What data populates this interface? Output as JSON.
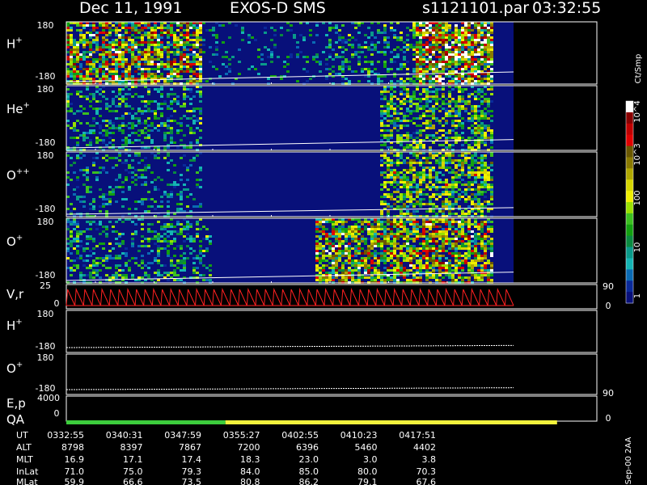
{
  "header": {
    "date": "Dec 11, 1991",
    "instrument": "EXOS-D SMS",
    "file": "s1121101.par",
    "time": "03:32:55"
  },
  "colorbar": {
    "units": "Ct/Smp",
    "ticks": [
      "10^4",
      "10^3",
      "100",
      "10",
      "1"
    ],
    "colors": [
      "#ffffff",
      "#8a0000",
      "#c00000",
      "#e00000",
      "#6a5800",
      "#8a7a00",
      "#b0a800",
      "#d6d600",
      "#f0f000",
      "#9ae000",
      "#3cc020",
      "#13a010",
      "#0a8a40",
      "#0a9a8a",
      "#14b4b4",
      "#0a6ab4",
      "#0a2a9a",
      "#08107a"
    ]
  },
  "chart_data": [
    {
      "type": "heatmap",
      "panel": "H+",
      "label": {
        "base": "H",
        "sup": "+"
      },
      "ylim": [
        -180,
        180
      ],
      "ticks": [
        "180",
        "-180"
      ],
      "activity": [
        {
          "t": [
            0,
            0.3
          ],
          "level": 0.75
        },
        {
          "t": [
            0.3,
            0.58
          ],
          "level": 0.15
        },
        {
          "t": [
            0.58,
            0.78
          ],
          "level": 0.35
        },
        {
          "t": [
            0.78,
            0.95
          ],
          "level": 0.85
        }
      ],
      "trace": [
        -180,
        -110
      ]
    },
    {
      "type": "heatmap",
      "panel": "He+",
      "label": {
        "base": "He",
        "sup": "+"
      },
      "ylim": [
        -180,
        180
      ],
      "ticks": [
        "180",
        "-180"
      ],
      "activity": [
        {
          "t": [
            0,
            0.3
          ],
          "level": 0.35
        },
        {
          "t": [
            0.7,
            0.95
          ],
          "level": 0.55
        }
      ],
      "trace": [
        -180,
        -120
      ]
    },
    {
      "type": "heatmap",
      "panel": "O++",
      "label": {
        "base": "O",
        "sup": "++"
      },
      "ylim": [
        -180,
        180
      ],
      "ticks": [
        "180",
        "-180"
      ],
      "activity": [
        {
          "t": [
            0,
            0.3
          ],
          "level": 0.25
        },
        {
          "t": [
            0.7,
            0.95
          ],
          "level": 0.6
        }
      ],
      "trace": [
        -180,
        -130
      ]
    },
    {
      "type": "heatmap",
      "panel": "O+",
      "label": {
        "base": "O",
        "sup": "+"
      },
      "ylim": [
        -180,
        180
      ],
      "ticks": [
        "180",
        "-180"
      ],
      "activity": [
        {
          "t": [
            0,
            0.32
          ],
          "level": 0.35
        },
        {
          "t": [
            0.55,
            0.95
          ],
          "level": 0.75
        }
      ],
      "trace": [
        -180,
        -120
      ]
    },
    {
      "type": "line",
      "panel": "V,r",
      "label": "V,r",
      "ylim": [
        0,
        25
      ],
      "ticks": [
        "25",
        "0"
      ],
      "right_ticks": [
        "90",
        "0"
      ],
      "sawtooth_periods": 52,
      "color": "#ff2020"
    },
    {
      "type": "line",
      "panel": "H+ trace",
      "label": {
        "base": "H",
        "sup": "+"
      },
      "ylim": [
        -180,
        180
      ],
      "ticks": [
        "180",
        "-180"
      ],
      "trace": [
        -180,
        -120
      ]
    },
    {
      "type": "line",
      "panel": "O+ trace",
      "label": {
        "base": "O",
        "sup": "+"
      },
      "ylim": [
        -180,
        180
      ],
      "ticks": [
        "180",
        "-180"
      ],
      "right_ticks": [
        "90",
        "0"
      ],
      "trace": [
        -180,
        -120
      ]
    },
    {
      "type": "bar",
      "panel": "E,p QA",
      "label": [
        "E,p",
        "QA"
      ],
      "ticks": [
        "4000",
        "0"
      ],
      "qa": [
        {
          "t": [
            0,
            0.3
          ],
          "color": "#3ccc3c"
        },
        {
          "t": [
            0.3,
            0.925
          ],
          "color": "#f2f23c"
        }
      ]
    }
  ],
  "time_table": {
    "rows": [
      {
        "name": "UT",
        "values": [
          "0332:55",
          "0340:31",
          "0347:59",
          "0355:27",
          "0402:55",
          "0410:23",
          "0417:51"
        ]
      },
      {
        "name": "ALT",
        "values": [
          "8798",
          "8397",
          "7867",
          "7200",
          "6396",
          "5460",
          "4402"
        ]
      },
      {
        "name": "MLT",
        "values": [
          "16.9",
          "17.1",
          "17.4",
          "18.3",
          "23.0",
          "3.0",
          "3.8"
        ]
      },
      {
        "name": "InLat",
        "values": [
          "71.0",
          "75.0",
          "79.3",
          "84.0",
          "85.0",
          "80.0",
          "70.3"
        ]
      },
      {
        "name": "MLat",
        "values": [
          "59.9",
          "66.6",
          "73.5",
          "80.8",
          "86.2",
          "79.1",
          "67.6"
        ]
      }
    ]
  },
  "footer": "Sep-00 2AA"
}
